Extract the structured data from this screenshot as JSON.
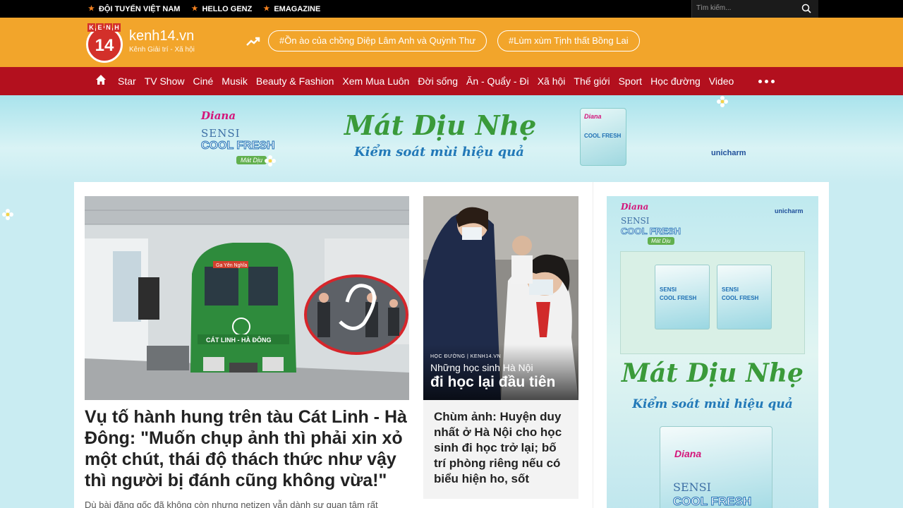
{
  "topbar": {
    "links": [
      "ĐỘI TUYỂN VIỆT NAM",
      "HELLO GENZ",
      "EMAGAZINE"
    ],
    "search_placeholder": "Tìm kiếm..."
  },
  "header": {
    "logo_top": [
      "K",
      "E",
      "N",
      "H"
    ],
    "logo_number": "14",
    "site_name": "kenh14.vn",
    "site_tagline": "Kênh Giải trí - Xã hội",
    "trending_tags": [
      "#Ồn ào của chồng Diệp Lâm Anh và Quỳnh Thư",
      "#Lùm xùm Tịnh thất Bồng Lai"
    ]
  },
  "nav": {
    "items": [
      "Star",
      "TV Show",
      "Ciné",
      "Musik",
      "Beauty & Fashion",
      "Xem Mua Luôn",
      "Đời sống",
      "Ăn - Quẩy - Đi",
      "Xã hội",
      "Thế giới",
      "Sport",
      "Học đường",
      "Video"
    ]
  },
  "banner_ad": {
    "brand": "Diana",
    "line1": "SENSI",
    "line2": "COOL FRESH",
    "badge": "Mát Dịu",
    "headline": "Mát Dịu Nhẹ",
    "subline": "Kiểm soát mùi hiệu quả",
    "maker": "unicharm",
    "colors": {
      "green": "#3a9a3a",
      "blue": "#2279b8",
      "pink": "#d4157a"
    }
  },
  "lead_story": {
    "title": "Vụ tố hành hung trên tàu Cát Linh - Hà Đông: \"Muốn chụp ảnh thì phải xin xỏ một chút, thái độ thách thức như vậy thì người bị đánh cũng không vừa!\"",
    "sapo": "Dù bài đăng gốc đã không còn nhưng netizen vẫn dành sự quan tâm rất",
    "photo_train_label": "CÁT LINH - HÀ ĐÔNG",
    "photo_screen_label": "Ga Yên Nghĩa"
  },
  "second_story": {
    "photo_category": "HỌC ĐƯỜNG | KENH14.VN",
    "photo_caption_line1": "Những học sinh Hà Nội",
    "photo_caption_line2": "đi học lại đầu tiên",
    "title": "Chùm ảnh: Huyện duy nhất ở Hà Nội cho học sinh đi học trở lại; bố trí phòng riêng nếu có biểu hiện ho, sốt"
  },
  "side_ad": {
    "brand": "Diana",
    "line1": "SENSI",
    "line2": "COOL FRESH",
    "badge": "Mát Dịu",
    "maker": "unicharm",
    "headline": "Mát Dịu Nhẹ",
    "subline": "Kiểm soát mùi hiệu quả"
  }
}
